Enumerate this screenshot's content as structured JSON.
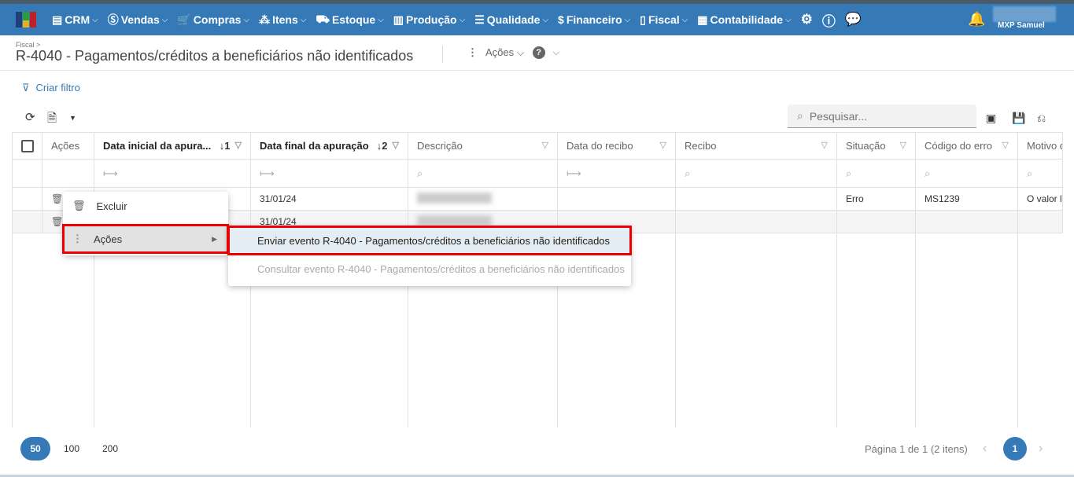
{
  "nav": {
    "items": [
      {
        "icon": "crm-icon",
        "glyph": "▤",
        "label": "CRM"
      },
      {
        "icon": "dollar-icon",
        "glyph": "Ⓢ",
        "label": "Vendas"
      },
      {
        "icon": "cart-icon",
        "glyph": "🛒",
        "label": "Compras"
      },
      {
        "icon": "items-icon",
        "glyph": "⁂",
        "label": "Itens"
      },
      {
        "icon": "stock-icon",
        "glyph": "⛟",
        "label": "Estoque"
      },
      {
        "icon": "factory-icon",
        "glyph": "▥",
        "label": "Produção"
      },
      {
        "icon": "checklist-icon",
        "glyph": "☰",
        "label": "Qualidade"
      },
      {
        "icon": "money-bag-icon",
        "glyph": "$",
        "label": "Financeiro"
      },
      {
        "icon": "document-check-icon",
        "glyph": "▯",
        "label": "Fiscal"
      },
      {
        "icon": "calculator-icon",
        "glyph": "▦",
        "label": "Contabilidade"
      }
    ],
    "user": "MXP Samuel"
  },
  "header": {
    "breadcrumb": "Fiscal >",
    "title": "R-4040 - Pagamentos/créditos a beneficiários não identificados",
    "actions": "Ações"
  },
  "filter": {
    "label": "Criar filtro"
  },
  "search": {
    "placeholder": "Pesquisar..."
  },
  "table": {
    "columns": [
      "Ações",
      "Data inicial da apura...",
      "Data final da apuração",
      "Descrição",
      "Data do recibo",
      "Recibo",
      "Situação",
      "Código do erro",
      "Motivo d"
    ],
    "sort1": "↓1",
    "sort2": "↓2",
    "rows": [
      {
        "data_final": "31/01/24",
        "situacao": "Erro",
        "codigo": "MS1239",
        "motivo": "O valor lí"
      },
      {
        "data_final": "31/01/24",
        "situacao": "",
        "codigo": "",
        "motivo": ""
      }
    ]
  },
  "context_menu": {
    "items": [
      "Excluir",
      "Ações"
    ],
    "submenu": [
      "Enviar evento R-4040 - Pagamentos/créditos a beneficiários não identificados",
      "Consultar evento R-4040 - Pagamentos/créditos a beneficiários não identificados"
    ]
  },
  "pagination": {
    "sizes": [
      "50",
      "100",
      "200"
    ],
    "selected_size": "50",
    "info": "Página 1 de 1 (2 itens)",
    "current": "1"
  }
}
